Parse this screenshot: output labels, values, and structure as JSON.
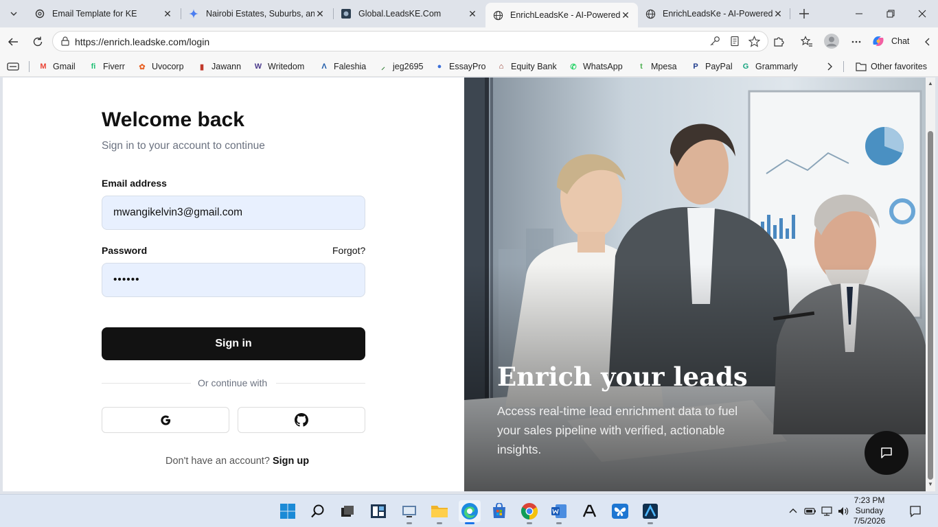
{
  "browser": {
    "tabs": [
      {
        "title": "Email Template for KE",
        "icon": "chatgpt-icon"
      },
      {
        "title": "Nairobi Estates, Suburbs, and S",
        "icon": "gemini-icon"
      },
      {
        "title": "Global.LeadsKE.Com",
        "icon": "site-icon"
      },
      {
        "title": "EnrichLeadsKe - AI-Powered Le",
        "icon": "globe-icon",
        "active": true
      },
      {
        "title": "EnrichLeadsKe - AI-Powered Le",
        "icon": "globe-icon"
      }
    ],
    "url": "https://enrich.leadske.com/login",
    "chat_label": "Chat",
    "bookmarks": [
      {
        "label": "Gmail",
        "color": "#ea4335",
        "glyph": "M"
      },
      {
        "label": "Fiverr",
        "color": "#1dbf73",
        "glyph": "fi"
      },
      {
        "label": "Uvocorp",
        "color": "#e8652a",
        "glyph": "✿"
      },
      {
        "label": "Jawann",
        "color": "#c0392b",
        "glyph": "▮"
      },
      {
        "label": "Writedom",
        "color": "#4b3a8c",
        "glyph": "W"
      },
      {
        "label": "Faleshia",
        "color": "#1e5aa8",
        "glyph": "Λ"
      },
      {
        "label": "jeg2695",
        "color": "#2e7d32",
        "glyph": "⸝"
      },
      {
        "label": "EssayPro",
        "color": "#3b6fd8",
        "glyph": "●"
      },
      {
        "label": "Equity Bank",
        "color": "#8b2b1f",
        "glyph": "⌂"
      },
      {
        "label": "WhatsApp",
        "color": "#25d366",
        "glyph": "✆"
      },
      {
        "label": "Mpesa",
        "color": "#4caf50",
        "glyph": "t"
      },
      {
        "label": "PayPal",
        "color": "#1f3b8c",
        "glyph": "P"
      },
      {
        "label": "Grammarly",
        "color": "#15a37f",
        "glyph": "G"
      }
    ],
    "other_favorites": "Other favorites"
  },
  "login": {
    "title": "Welcome back",
    "subtitle": "Sign in to your account to continue",
    "email_label": "Email address",
    "email_value": "mwangikelvin3@gmail.com",
    "password_label": "Password",
    "forgot_label": "Forgot?",
    "password_value": "••••••",
    "signin_label": "Sign in",
    "divider_text": "Or continue with",
    "no_account_text": "Don't have an account?",
    "signup_label": "Sign up"
  },
  "hero": {
    "title": "Enrich your leads",
    "subtitle": "Access real-time lead enrichment data to fuel your sales pipeline with verified, actionable insights."
  },
  "taskbar": {
    "time": "7:23 PM",
    "day": "Sunday",
    "date": "7/5/2026"
  },
  "colors": {
    "primary_button": "#121212",
    "input_background": "#e8f0fe",
    "muted_text": "#6b7280"
  }
}
